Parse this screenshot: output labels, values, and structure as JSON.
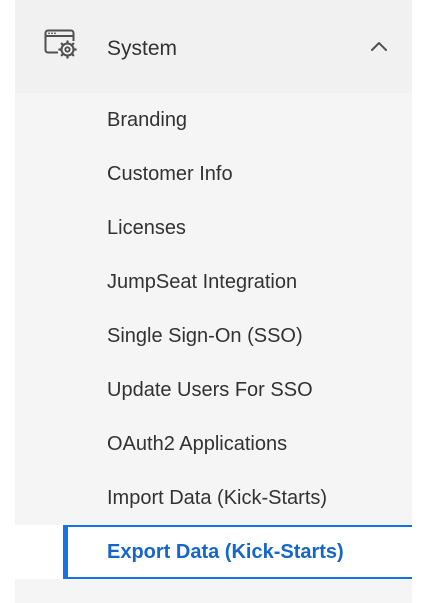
{
  "section": {
    "title": "System",
    "icon": "system-settings-icon",
    "expand_icon": "chevron-up-icon",
    "expanded": true
  },
  "items": [
    {
      "label": "Branding",
      "active": false
    },
    {
      "label": "Customer Info",
      "active": false
    },
    {
      "label": "Licenses",
      "active": false
    },
    {
      "label": "JumpSeat Integration",
      "active": false
    },
    {
      "label": "Single Sign-On (SSO)",
      "active": false
    },
    {
      "label": "Update Users For SSO",
      "active": false
    },
    {
      "label": "OAuth2 Applications",
      "active": false
    },
    {
      "label": "Import Data (Kick-Starts)",
      "active": false
    },
    {
      "label": "Export Data (Kick-Starts)",
      "active": true
    }
  ],
  "colors": {
    "accent": "#1473e6",
    "active_text": "#1467c9",
    "text": "#323232",
    "nav_background": "#f5f5f5",
    "header_background": "#f1f1f1"
  }
}
